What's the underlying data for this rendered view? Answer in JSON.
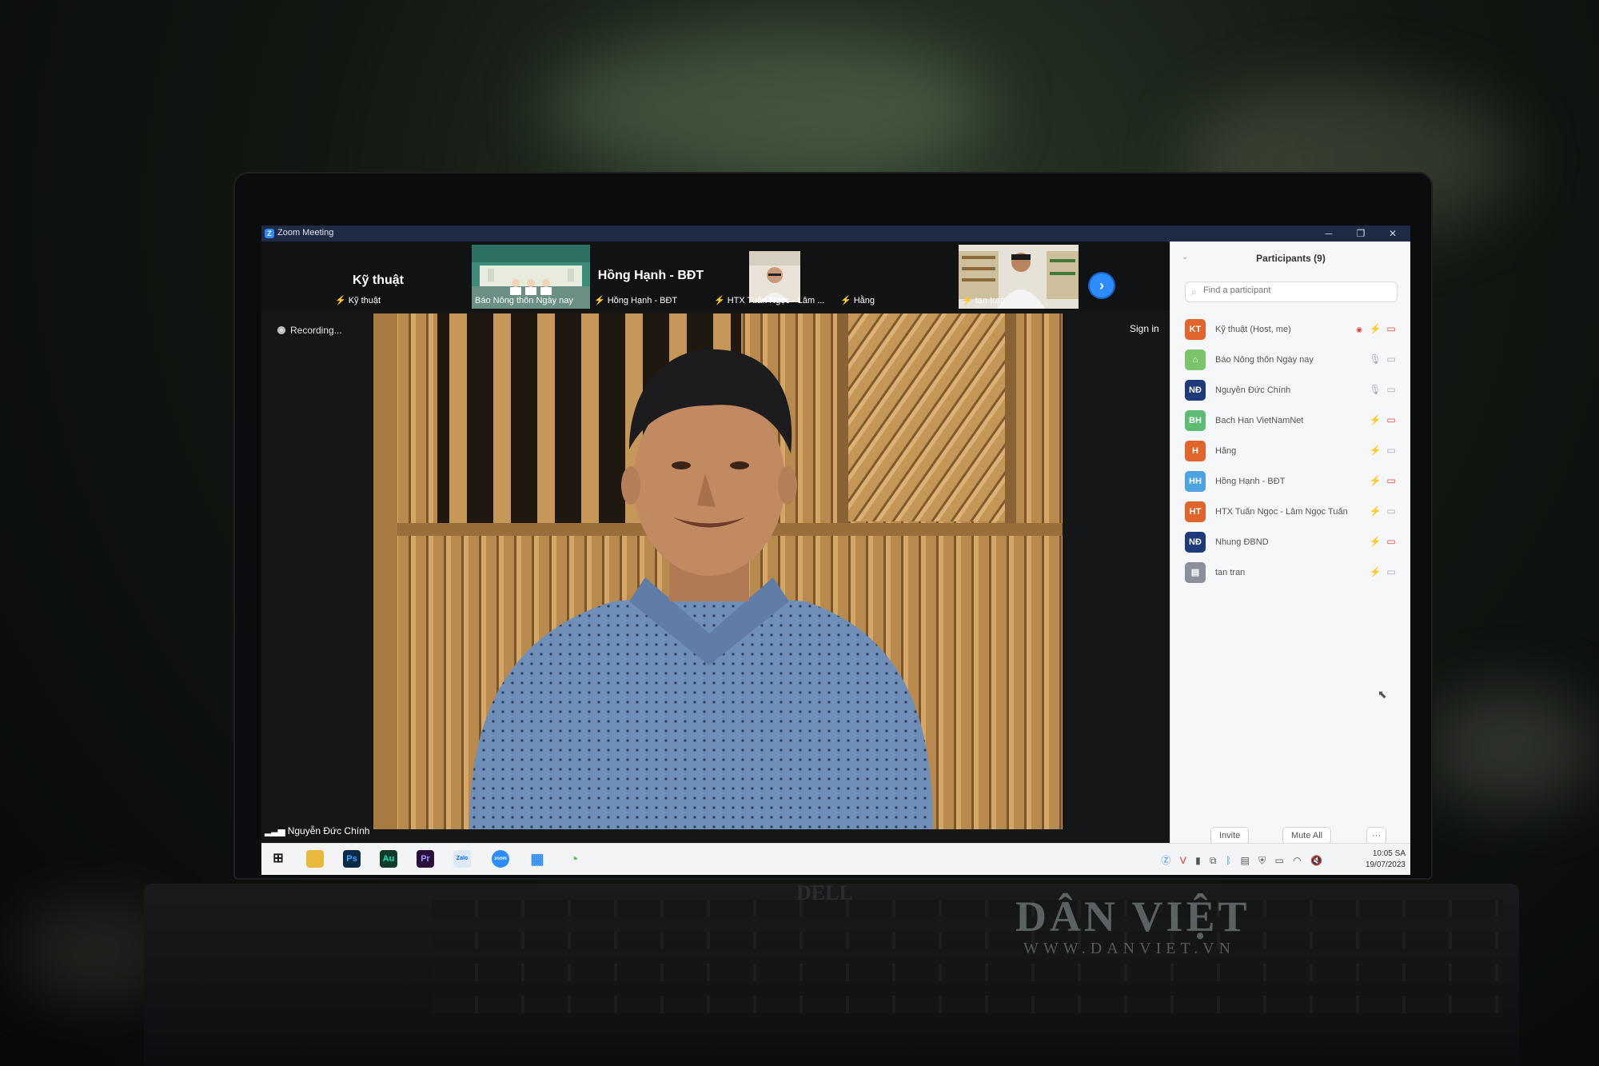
{
  "window": {
    "title": "Zoom Meeting",
    "app_icon": "Z"
  },
  "thumbnails": [
    {
      "name": "Kỹ thuật",
      "label": "Kỹ thuật",
      "mic_muted": true,
      "has_video": false
    },
    {
      "name": "Báo Nông thôn Ngày nay",
      "label": "Báo Nông thôn Ngày nay",
      "mic_muted": false,
      "has_video": true
    },
    {
      "name": "Hồng Hạnh - BĐT",
      "label": "Hồng Hạnh - BĐT",
      "mic_muted": true,
      "has_video": false
    },
    {
      "name": "HTX Tuấn Ngọc - Lâm ...",
      "label": "HTX Tuấn Ngọc - Lâm ...",
      "mic_muted": true,
      "has_video": true
    },
    {
      "name": "Hằng",
      "label": "Hằng",
      "mic_muted": true,
      "has_video": false
    },
    {
      "name": "tan tran",
      "label": "tan tran",
      "mic_muted": true,
      "has_video": true
    }
  ],
  "meeting": {
    "recording_label": "Recording...",
    "sign_in": "Sign in",
    "active_speaker": "Nguyễn Đức Chính"
  },
  "participants_panel": {
    "title": "Participants (9)",
    "search_placeholder": "Find a participant",
    "participants": [
      {
        "initials": "KT",
        "name": "Kỹ thuật (Host, me)",
        "color": "#e0652d",
        "mic": "muted",
        "video": "off",
        "recording": true
      },
      {
        "initials": "",
        "name": "Báo Nông thôn Ngày nay",
        "color": "#7cc36b",
        "mic": "on",
        "video": "on",
        "recording": false
      },
      {
        "initials": "NĐ",
        "name": "Nguyễn Đức Chính",
        "color": "#1e3a78",
        "mic": "on",
        "video": "on",
        "recording": false
      },
      {
        "initials": "BH",
        "name": "Bach Han VietNamNet",
        "color": "#5dbb73",
        "mic": "muted",
        "video": "off",
        "recording": false
      },
      {
        "initials": "H",
        "name": "Hằng",
        "color": "#e0652d",
        "mic": "muted",
        "video": "on",
        "recording": false
      },
      {
        "initials": "HH",
        "name": "Hồng Hạnh - BĐT",
        "color": "#4da3e0",
        "mic": "muted",
        "video": "off",
        "recording": false
      },
      {
        "initials": "HT",
        "name": "HTX Tuấn Ngọc - Lâm Ngọc Tuấn",
        "color": "#e0652d",
        "mic": "muted",
        "video": "on",
        "recording": false
      },
      {
        "initials": "NĐ",
        "name": "Nhung ĐBND",
        "color": "#1e3a78",
        "mic": "muted",
        "video": "off",
        "recording": false
      },
      {
        "initials": "",
        "name": "tan tran",
        "color": "#8a8f99",
        "mic": "muted",
        "video": "on",
        "recording": false
      }
    ],
    "invite_label": "Invite",
    "mute_all_label": "Mute All",
    "more_label": "···"
  },
  "taskbar": {
    "apps": [
      {
        "name": "windows-start-icon",
        "glyph": "⊞",
        "color": "#1a1a1a"
      },
      {
        "name": "file-explorer-icon",
        "glyph": "▆",
        "color": "#e9b93b"
      },
      {
        "name": "photoshop-icon",
        "glyph": "Ps",
        "color": "#0b2a4a"
      },
      {
        "name": "audition-icon",
        "glyph": "Au",
        "color": "#103a2a"
      },
      {
        "name": "premiere-icon",
        "glyph": "Pr",
        "color": "#2a0f3d"
      },
      {
        "name": "zalo-icon",
        "glyph": "Zalo",
        "color": "#dfe9f6"
      },
      {
        "name": "zoom-icon",
        "glyph": "zoom",
        "color": "#2d8cff"
      },
      {
        "name": "apps-grid-icon",
        "glyph": "▦",
        "color": "#dfe9f6"
      },
      {
        "name": "coc-coc-icon",
        "glyph": "◔",
        "color": "#dff2d8"
      }
    ],
    "time": "10:05 SA",
    "date": "19/07/2023"
  },
  "watermark": {
    "brand": "DÂN VIỆT",
    "url": "WWW.DANVIET.VN"
  },
  "laptop_logo": "DELL"
}
